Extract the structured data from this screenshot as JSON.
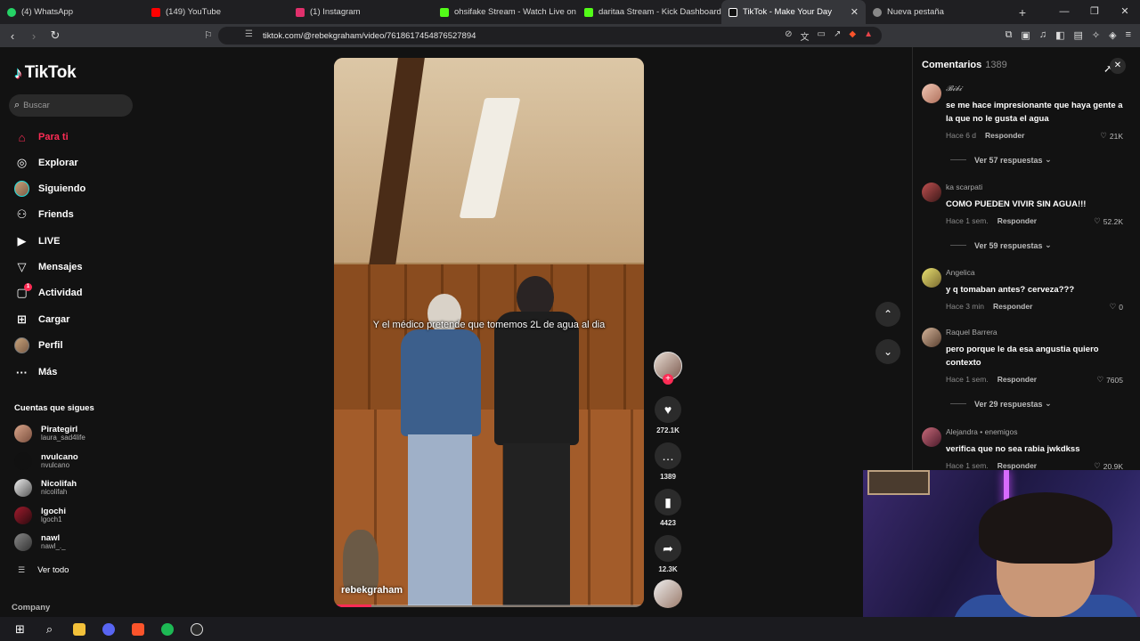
{
  "browser": {
    "tabs": [
      {
        "title": "(4) WhatsApp",
        "color": "#25d366",
        "active": false
      },
      {
        "title": "(149) YouTube",
        "color": "#ff0000",
        "active": false
      },
      {
        "title": "(1) Instagram",
        "color": "#e1306c",
        "active": false
      },
      {
        "title": "ohsifake Stream - Watch Live on Kick",
        "color": "#53fc18",
        "active": false
      },
      {
        "title": "daritaa Stream - Kick Dashboard",
        "color": "#53fc18",
        "active": false
      },
      {
        "title": "TikTok - Make Your Day",
        "color": "#ffffff",
        "active": true
      },
      {
        "title": "Nueva pestaña",
        "color": "#888888",
        "active": false
      }
    ],
    "url": "tiktok.com/@rebekgraham/video/7618617454876527894"
  },
  "sidebar": {
    "logo": "TikTok",
    "search_placeholder": "Buscar",
    "nav": [
      {
        "label": "Para ti",
        "icon": "home-icon",
        "active": true
      },
      {
        "label": "Explorar",
        "icon": "compass-icon"
      },
      {
        "label": "Siguiendo",
        "icon": "avatar-icon"
      },
      {
        "label": "Friends",
        "icon": "friends-icon"
      },
      {
        "label": "LIVE",
        "icon": "live-icon"
      },
      {
        "label": "Mensajes",
        "icon": "messages-icon"
      },
      {
        "label": "Actividad",
        "icon": "activity-icon",
        "badge": "1"
      },
      {
        "label": "Cargar",
        "icon": "upload-icon"
      },
      {
        "label": "Perfil",
        "icon": "profile-icon"
      },
      {
        "label": "Más",
        "icon": "more-icon"
      }
    ],
    "following_title": "Cuentas que sigues",
    "following": [
      {
        "name": "Pirategirl",
        "user": "laura_sad4life"
      },
      {
        "name": "nvulcano",
        "user": "nvulcano"
      },
      {
        "name": "Nicolifah",
        "user": "nicolifah"
      },
      {
        "name": "lgochi",
        "user": "lgoch1"
      },
      {
        "name": "nawl",
        "user": "nawl_._"
      }
    ],
    "see_all": "Ver todo",
    "company": "Company"
  },
  "video": {
    "caption": "Y el  médico pretende que tomemos  2L de agua al dia",
    "username": "rebekgraham",
    "progress": 0.12
  },
  "actions": {
    "likes": "272.1K",
    "comments": "1389",
    "saves": "4423",
    "shares": "12.3K"
  },
  "comments": {
    "title": "Comentarios",
    "count": "1389",
    "items": [
      {
        "user": "𝓑𝓲𝓫𝓲",
        "text": "se me hace impresionante que haya gente a la que no le gusta el agua",
        "time": "Hace 6 d",
        "reply": "Responder",
        "likes": "21K",
        "replies": "Ver 57 respuestas"
      },
      {
        "user": "ka scarpati",
        "text": "COMO PUEDEN VIVIR SIN AGUA!!!",
        "time": "Hace 1 sem.",
        "reply": "Responder",
        "likes": "52.2K",
        "replies": "Ver 59 respuestas"
      },
      {
        "user": "Angelica",
        "text": "y q tomaban antes? cerveza???",
        "time": "Hace 3 min",
        "reply": "Responder",
        "likes": "0",
        "replies": ""
      },
      {
        "user": "Raquel Barrera",
        "text": "pero porque le da esa angustia quiero contexto",
        "time": "Hace 1 sem.",
        "reply": "Responder",
        "likes": "7605",
        "replies": "Ver 29 respuestas"
      },
      {
        "user": "Alejandra • enemigos",
        "text": "verifica que no sea rabia jwkdkss",
        "time": "Hace 1 sem.",
        "reply": "Responder",
        "likes": "20.9K",
        "replies": ""
      }
    ]
  }
}
